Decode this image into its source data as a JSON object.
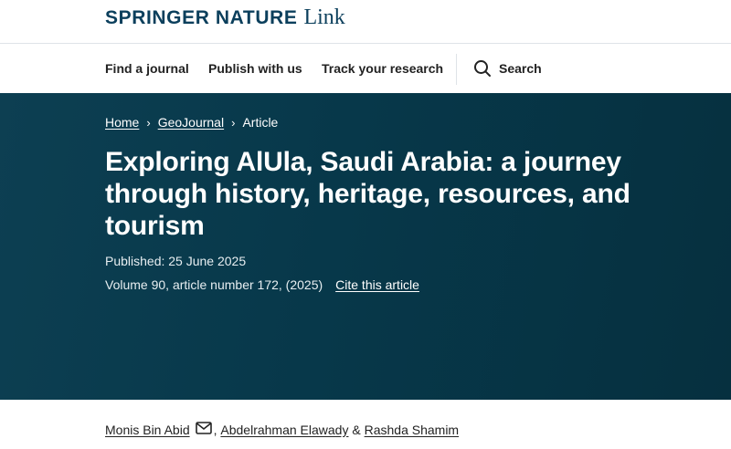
{
  "header": {
    "brand": "SPRINGER NATURE",
    "brand_suffix": "Link"
  },
  "nav": {
    "items": [
      "Find a journal",
      "Publish with us",
      "Track your research"
    ],
    "search_label": "Search"
  },
  "breadcrumb": {
    "home": "Home",
    "journal": "GeoJournal",
    "current": "Article"
  },
  "article": {
    "title": "Exploring AlUla, Saudi Arabia: a journey through history, heritage, resources, and tourism",
    "published": "Published: 25 June 2025",
    "volume": "Volume 90, article number 172, (2025)",
    "cite_label": "Cite this article"
  },
  "authors": {
    "list": [
      "Monis Bin Abid",
      "Abdelrahman Elawady",
      "Rashda Shamim"
    ],
    "comma": ",",
    "ampersand": "&"
  },
  "colors": {
    "brand": "#0b3f5c",
    "hero_bg": "#07384a"
  }
}
